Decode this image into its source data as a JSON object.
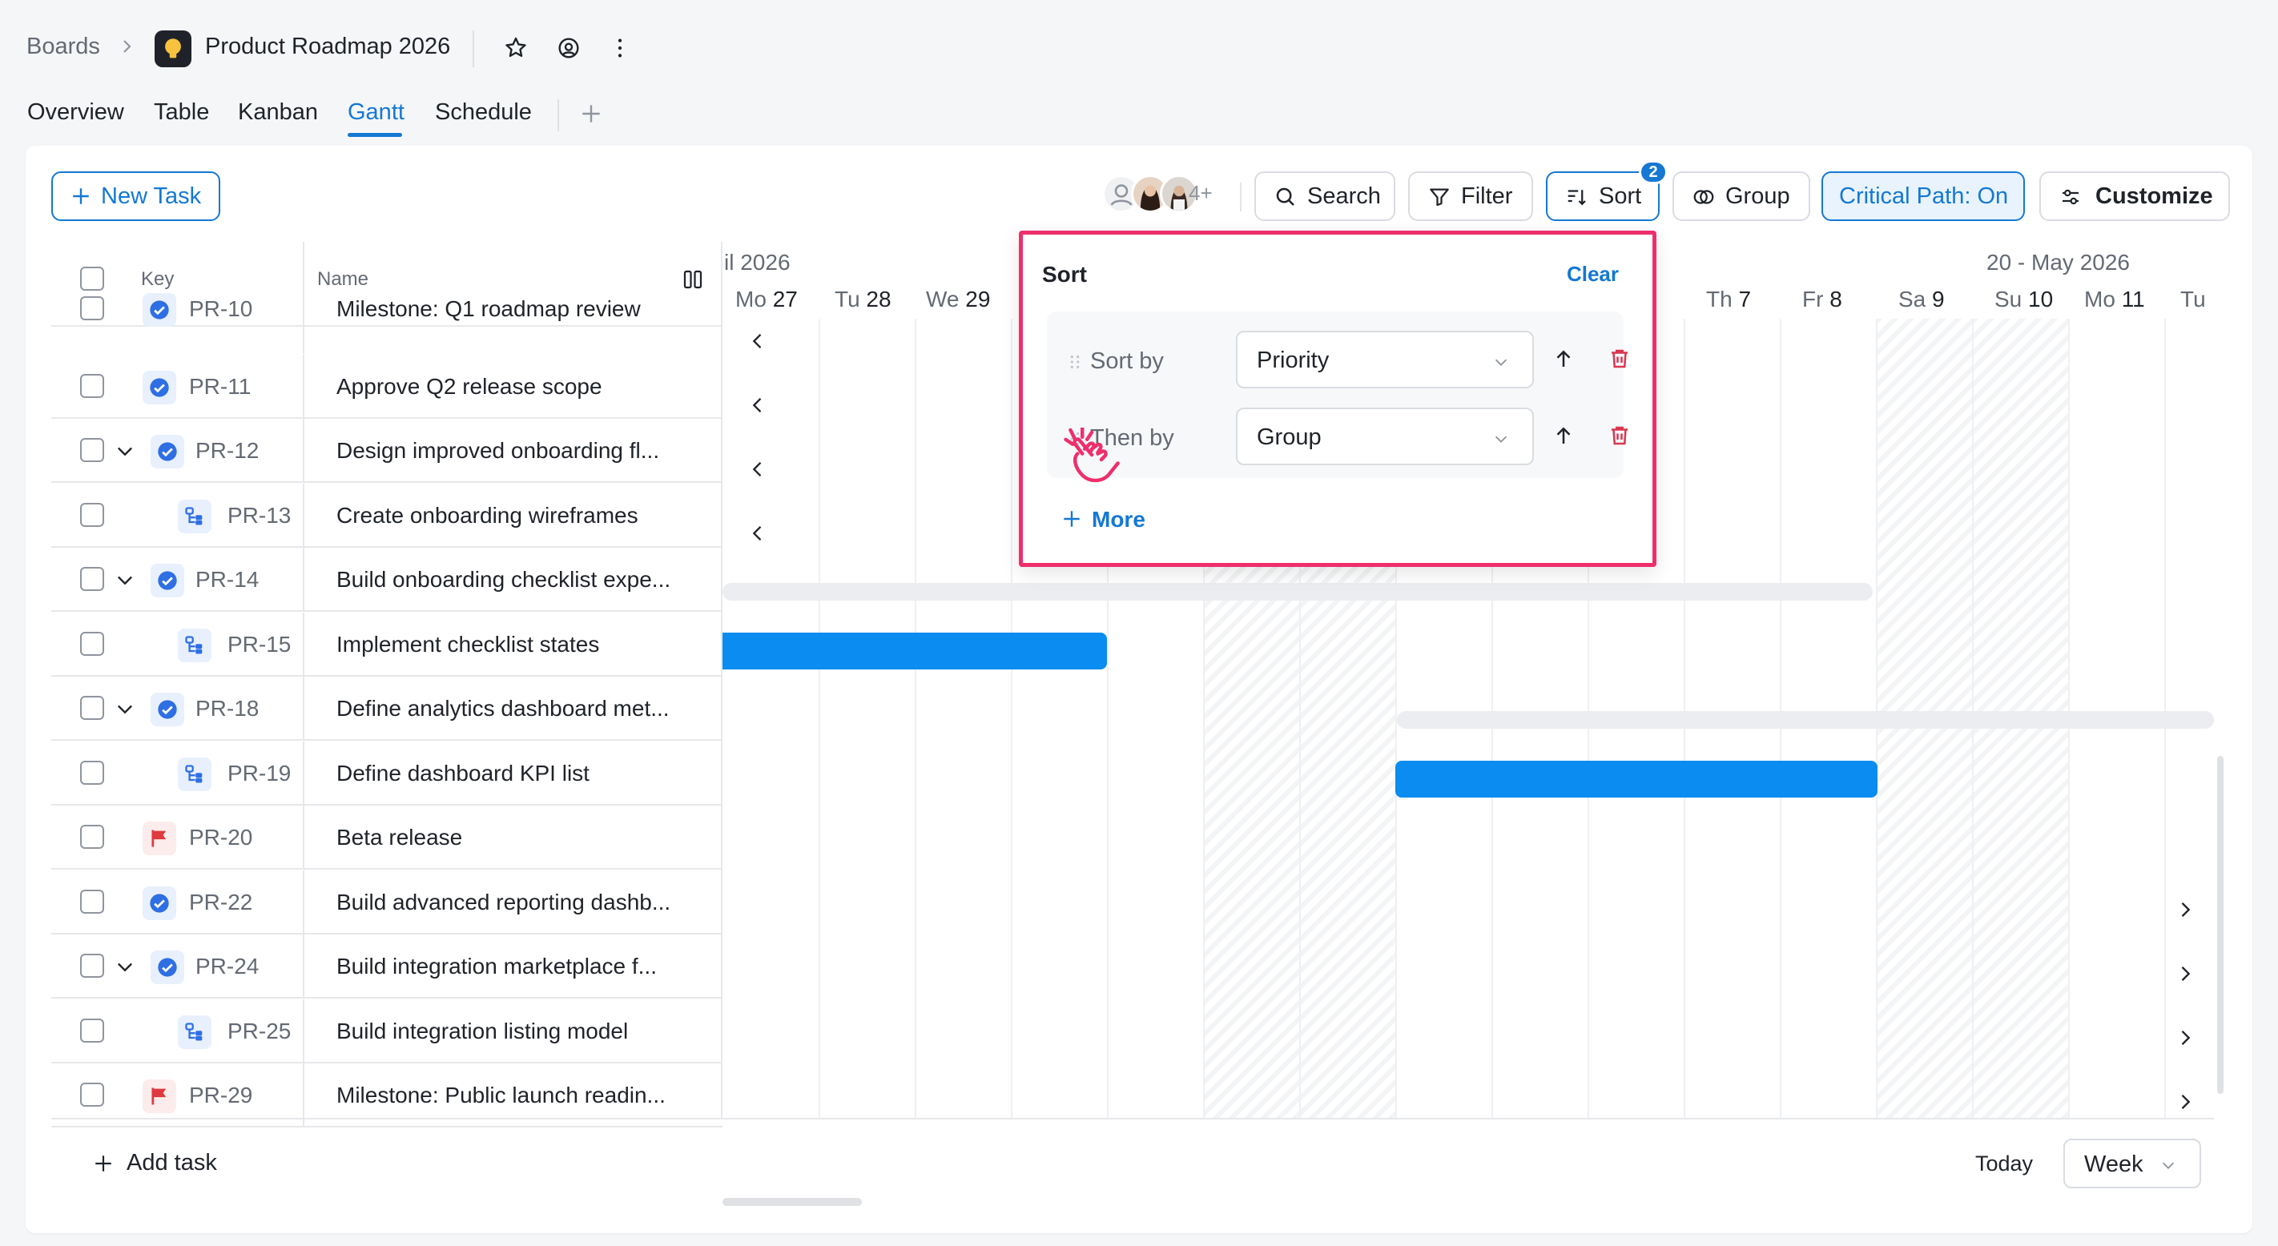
{
  "breadcrumb": {
    "root": "Boards",
    "board_title": "Product Roadmap 2026"
  },
  "views": {
    "tabs": [
      "Overview",
      "Table",
      "Kanban",
      "Gantt",
      "Schedule"
    ],
    "active": "Gantt"
  },
  "toolbar": {
    "new_task": "New Task",
    "members_more": "4+",
    "search": "Search",
    "filter": "Filter",
    "sort": "Sort",
    "sort_count": "2",
    "group": "Group",
    "critical_path": "Critical Path: On",
    "customize": "Customize"
  },
  "table": {
    "headers": {
      "key": "Key",
      "name": "Name"
    },
    "rows": [
      {
        "key": "PR-10",
        "name": "Milestone: Q1 roadmap review",
        "icon": "task-check-icon",
        "expandable": false,
        "indent": false
      },
      {
        "key": "PR-11",
        "name": "Approve Q2 release scope",
        "icon": "task-check-icon",
        "expandable": false,
        "indent": false
      },
      {
        "key": "PR-12",
        "name": "Design improved onboarding fl...",
        "icon": "task-check-icon",
        "expandable": true,
        "indent": false
      },
      {
        "key": "PR-13",
        "name": "Create onboarding wireframes",
        "icon": "subtask-icon",
        "expandable": false,
        "indent": true
      },
      {
        "key": "PR-14",
        "name": "Build onboarding checklist expe...",
        "icon": "task-check-icon",
        "expandable": true,
        "indent": false
      },
      {
        "key": "PR-15",
        "name": "Implement checklist states",
        "icon": "subtask-icon",
        "expandable": false,
        "indent": true
      },
      {
        "key": "PR-18",
        "name": "Define analytics dashboard met...",
        "icon": "task-check-icon",
        "expandable": true,
        "indent": false
      },
      {
        "key": "PR-19",
        "name": "Define dashboard KPI list",
        "icon": "subtask-icon",
        "expandable": false,
        "indent": true
      },
      {
        "key": "PR-20",
        "name": "Beta release",
        "icon": "flag-icon",
        "expandable": false,
        "indent": false
      },
      {
        "key": "PR-22",
        "name": "Build advanced reporting dashb...",
        "icon": "task-check-icon",
        "expandable": false,
        "indent": false
      },
      {
        "key": "PR-24",
        "name": "Build integration marketplace f...",
        "icon": "task-check-icon",
        "expandable": true,
        "indent": false
      },
      {
        "key": "PR-25",
        "name": "Build integration listing model",
        "icon": "subtask-icon",
        "expandable": false,
        "indent": true
      },
      {
        "key": "PR-29",
        "name": "Milestone: Public launch readin...",
        "icon": "flag-icon",
        "expandable": false,
        "indent": false
      }
    ]
  },
  "timeline": {
    "month_left": "il 2026",
    "month_right": "20 - May 2026",
    "days": [
      {
        "dow": "Mo",
        "num": "27"
      },
      {
        "dow": "Tu",
        "num": "28"
      },
      {
        "dow": "We",
        "num": "29"
      },
      {
        "dow": "Th",
        "num": "7"
      },
      {
        "dow": "Fr",
        "num": "8"
      },
      {
        "dow": "Sa",
        "num": "9"
      },
      {
        "dow": "Su",
        "num": "10"
      },
      {
        "dow": "Mo",
        "num": "11"
      },
      {
        "dow": "Tu",
        "num": ""
      }
    ],
    "partial_day_glyph": "o"
  },
  "sort_panel": {
    "title": "Sort",
    "clear": "Clear",
    "rules": [
      {
        "label": "Sort by",
        "value": "Priority",
        "direction": "ascending"
      },
      {
        "label": "Then by",
        "value": "Group",
        "direction": "ascending"
      }
    ],
    "more": "More"
  },
  "footer": {
    "add_task": "Add task",
    "today": "Today",
    "scale": "Week"
  },
  "colors": {
    "accent": "#1478d4",
    "bar": "#0a8cf0",
    "highlight_border": "#ee2f6b",
    "delete": "#d9364f",
    "flag": "#e0393e"
  }
}
